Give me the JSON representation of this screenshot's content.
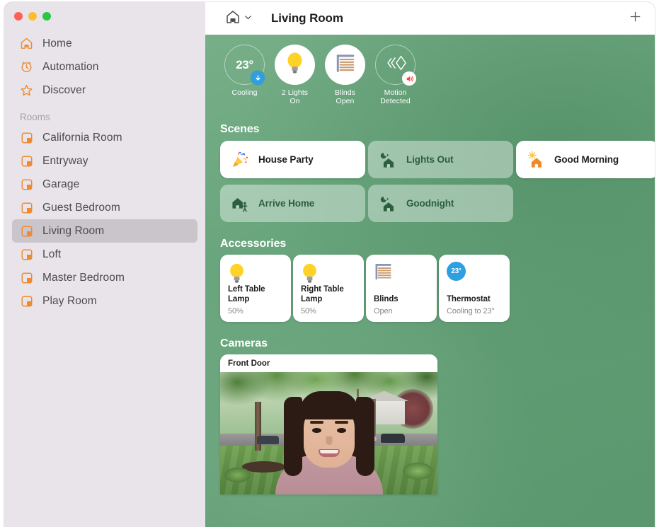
{
  "window": {
    "traffic_lights": [
      "close",
      "minimize",
      "maximize"
    ]
  },
  "sidebar": {
    "top_items": [
      {
        "label": "Home",
        "icon": "home-icon"
      },
      {
        "label": "Automation",
        "icon": "clock-icon"
      },
      {
        "label": "Discover",
        "icon": "star-icon"
      }
    ],
    "section_header": "Rooms",
    "rooms": [
      {
        "label": "California Room",
        "selected": false
      },
      {
        "label": "Entryway",
        "selected": false
      },
      {
        "label": "Garage",
        "selected": false
      },
      {
        "label": "Guest Bedroom",
        "selected": false
      },
      {
        "label": "Living Room",
        "selected": true
      },
      {
        "label": "Loft",
        "selected": false
      },
      {
        "label": "Master Bedroom",
        "selected": false
      },
      {
        "label": "Play Room",
        "selected": false
      }
    ]
  },
  "toolbar": {
    "home_icon": "home-icon",
    "chevron_icon": "chevron-down-icon",
    "title": "Living Room",
    "add_icon": "plus-icon"
  },
  "status": [
    {
      "value": "23°",
      "label": "Cooling",
      "style": "outline",
      "icon": "temperature-value",
      "badge": "arrow-down-badge"
    },
    {
      "value": "",
      "label": "2 Lights\nOn",
      "style": "filled",
      "icon": "lightbulb-icon",
      "badge": ""
    },
    {
      "value": "",
      "label": "Blinds\nOpen",
      "style": "filled",
      "icon": "blinds-icon",
      "badge": ""
    },
    {
      "value": "",
      "label": "Motion Detected",
      "style": "outline",
      "icon": "motion-sensor-icon",
      "badge": "sound-badge"
    }
  ],
  "scenes": {
    "title": "Scenes",
    "items": [
      {
        "label": "House Party",
        "state": "on",
        "icon": "party-popper-icon"
      },
      {
        "label": "Lights Out",
        "state": "off",
        "icon": "house-moon-icon"
      },
      {
        "label": "Good Morning",
        "state": "on",
        "icon": "house-sun-icon"
      },
      {
        "label": "Arrive Home",
        "state": "off",
        "icon": "house-person-icon"
      },
      {
        "label": "Goodnight",
        "state": "off",
        "icon": "house-moon-icon"
      }
    ]
  },
  "accessories": {
    "title": "Accessories",
    "items": [
      {
        "name": "Left Table Lamp",
        "state": "50%",
        "icon": "lightbulb-icon"
      },
      {
        "name": "Right Table Lamp",
        "state": "50%",
        "icon": "lightbulb-icon"
      },
      {
        "name": "Blinds",
        "state": "Open",
        "icon": "blinds-icon"
      },
      {
        "name": "Thermostat",
        "state": "Cooling to 23°",
        "icon": "thermostat-icon",
        "badge_value": "23°"
      }
    ]
  },
  "cameras": {
    "title": "Cameras",
    "items": [
      {
        "name": "Front Door"
      }
    ]
  },
  "colors": {
    "accent_orange": "#ef8a33",
    "sidebar_bg": "#e8e4e9",
    "selected_row": "#c9c5ca",
    "panel_green": "#6aa67d",
    "scene_off_green": "#2c5f3e",
    "thermostat_blue": "#2e9fe0",
    "bulb_yellow": "#ffd13b"
  }
}
